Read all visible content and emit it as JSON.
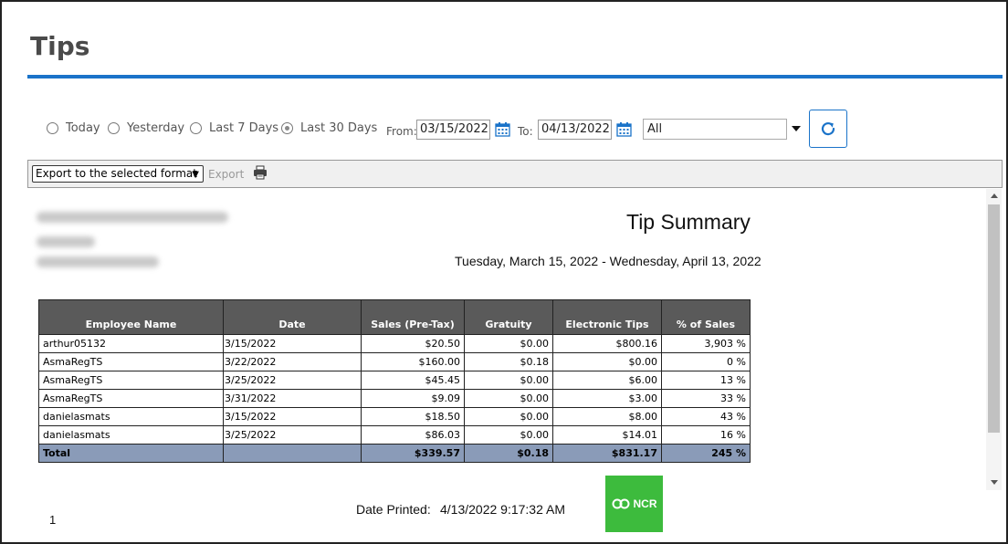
{
  "page": {
    "title": "Tips"
  },
  "filters": {
    "ranges": [
      {
        "label": "Today",
        "checked": false
      },
      {
        "label": "Yesterday",
        "checked": false
      },
      {
        "label": "Last 7 Days",
        "checked": false
      },
      {
        "label": "Last 30 Days",
        "checked": true
      }
    ],
    "from_label": "From:",
    "from_value": "03/15/2022",
    "to_label": "To:",
    "to_value": "04/13/2022",
    "select_value": "All"
  },
  "toolbar": {
    "export_format": "Export to the selected format",
    "export_label": "Export"
  },
  "report": {
    "title": "Tip Summary",
    "range": "Tuesday, March 15, 2022 - Wednesday, April 13, 2022",
    "columns": [
      "Employee Name",
      "Date",
      "Sales (Pre-Tax)",
      "Gratuity",
      "Electronic Tips",
      "% of Sales"
    ],
    "rows": [
      [
        "arthur05132",
        "3/15/2022",
        "$20.50",
        "$0.00",
        "$800.16",
        "3,903 %"
      ],
      [
        "AsmaRegTS",
        "3/22/2022",
        "$160.00",
        "$0.18",
        "$0.00",
        "0 %"
      ],
      [
        "AsmaRegTS",
        "3/25/2022",
        "$45.45",
        "$0.00",
        "$6.00",
        "13 %"
      ],
      [
        "AsmaRegTS",
        "3/31/2022",
        "$9.09",
        "$0.00",
        "$3.00",
        "33 %"
      ],
      [
        "danielasmats",
        "3/15/2022",
        "$18.50",
        "$0.00",
        "$8.00",
        "43 %"
      ],
      [
        "danielasmats",
        "3/25/2022",
        "$86.03",
        "$0.00",
        "$14.01",
        "16 %"
      ]
    ],
    "total": [
      "Total",
      "",
      "$339.57",
      "$0.18",
      "$831.17",
      "245 %"
    ],
    "page_number": "1",
    "printed_label": "Date Printed:",
    "printed_value": "4/13/2022 9:17:32 AM",
    "logo_text": "NCR"
  },
  "colors": {
    "accent": "#1a73c9",
    "header_bg": "#5a5a5a",
    "total_bg": "#8a9bb8",
    "logo_green": "#3dbb3d"
  }
}
